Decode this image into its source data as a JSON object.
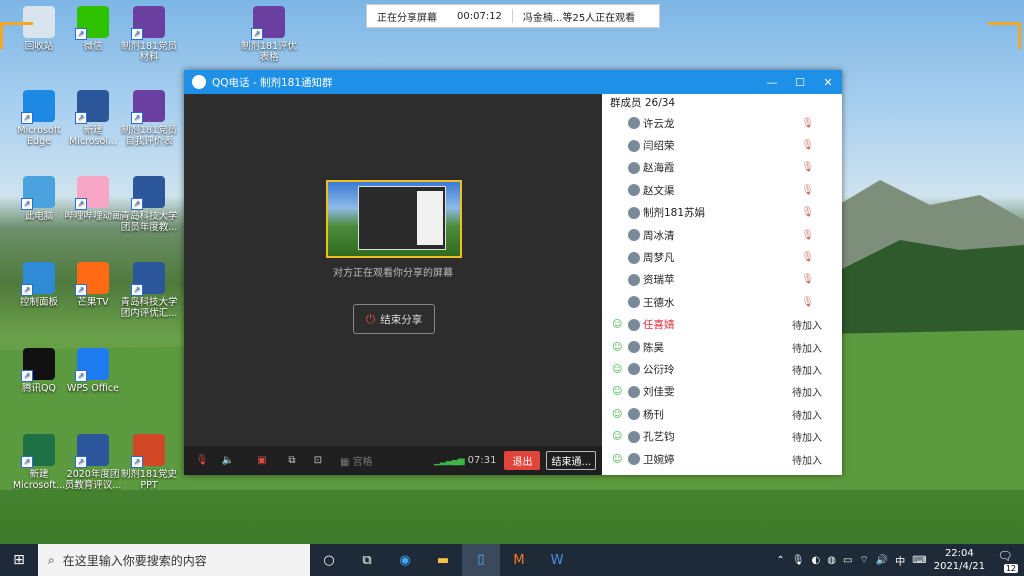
{
  "desktop_icons": [
    {
      "label": "回收站",
      "icon": "recycle-bin-icon",
      "color": "#d9e4ef"
    },
    {
      "label": "微信",
      "icon": "wechat-icon",
      "color": "#2dc100"
    },
    {
      "label": "制剂181党员材料",
      "icon": "winrar-archive-icon",
      "color": "#6a3fa0"
    },
    {
      "label": "制剂181评优表格",
      "icon": "winrar-archive-icon",
      "color": "#6a3fa0"
    },
    {
      "label": "Microsoft Edge",
      "icon": "edge-icon",
      "color": "#1e88e5"
    },
    {
      "label": "新建 Microsol...",
      "icon": "word-doc-icon",
      "color": "#2b579a"
    },
    {
      "label": "制剂181党员自我评价表",
      "icon": "winrar-archive-icon",
      "color": "#6a3fa0"
    },
    {
      "label": "此电脑",
      "icon": "this-pc-icon",
      "color": "#4aa3df"
    },
    {
      "label": "哔哩哔哩动画",
      "icon": "bilibili-icon",
      "color": "#f7a6c6"
    },
    {
      "label": "青岛科技大学团员年度教...",
      "icon": "word-doc-icon",
      "color": "#2b579a"
    },
    {
      "label": "控制面板",
      "icon": "control-panel-icon",
      "color": "#2e8bd6"
    },
    {
      "label": "芒果TV",
      "icon": "mango-tv-icon",
      "color": "#ff6a13"
    },
    {
      "label": "青岛科技大学团内评优汇...",
      "icon": "word-doc-icon",
      "color": "#2b579a"
    },
    {
      "label": "腾讯QQ",
      "icon": "qq-penguin-icon",
      "color": "#111111"
    },
    {
      "label": "WPS Office",
      "icon": "wps-office-icon",
      "color": "#1e7bf0"
    },
    {
      "label": "新建 Microsoft...",
      "icon": "excel-sheet-icon",
      "color": "#1e7145"
    },
    {
      "label": "2020年度团员教育评议...",
      "icon": "word-doc-icon",
      "color": "#2b579a"
    },
    {
      "label": "制剂181党史PPT",
      "icon": "ppt-icon",
      "color": "#d24726"
    }
  ],
  "share_bar": {
    "status": "正在分享屏幕",
    "timer": "00:07:12",
    "watchers": "冯金楠...等25人正在观看"
  },
  "window": {
    "title": "QQ电话 - 制剂181通知群",
    "minimize": "—",
    "maximize": "☐",
    "close": "✕"
  },
  "call": {
    "note": "对方正在观看你分享的屏幕",
    "end_share": "结束分享"
  },
  "toolbar": {
    "grid_label": "宫格",
    "time": "07:31",
    "exit": "退出",
    "end": "结束通..."
  },
  "members": {
    "header": "群成员 26/34",
    "list": [
      {
        "name": "许云龙",
        "status": ""
      },
      {
        "name": "闫绍荣",
        "status": ""
      },
      {
        "name": "赵海霞",
        "status": ""
      },
      {
        "name": "赵文渠",
        "status": ""
      },
      {
        "name": "制剂181苏娟",
        "status": ""
      },
      {
        "name": "周冰清",
        "status": ""
      },
      {
        "name": "周梦凡",
        "status": ""
      },
      {
        "name": "资瑞苹",
        "status": ""
      },
      {
        "name": "王德水",
        "status": ""
      },
      {
        "name": "任喜婧",
        "status": "待加入"
      },
      {
        "name": "陈昊",
        "status": "待加入"
      },
      {
        "name": "公衍玲",
        "status": "待加入"
      },
      {
        "name": "刘佳雯",
        "status": "待加入"
      },
      {
        "name": "杨刊",
        "status": "待加入"
      },
      {
        "name": "孔艺钧",
        "status": "待加入"
      },
      {
        "name": "卫婉婷",
        "status": "待加入"
      }
    ]
  },
  "taskbar": {
    "search_placeholder": "在这里输入你要搜索的内容",
    "tray_lang": "中",
    "time": "22:04",
    "date": "2021/4/21",
    "notif_count": "12"
  }
}
